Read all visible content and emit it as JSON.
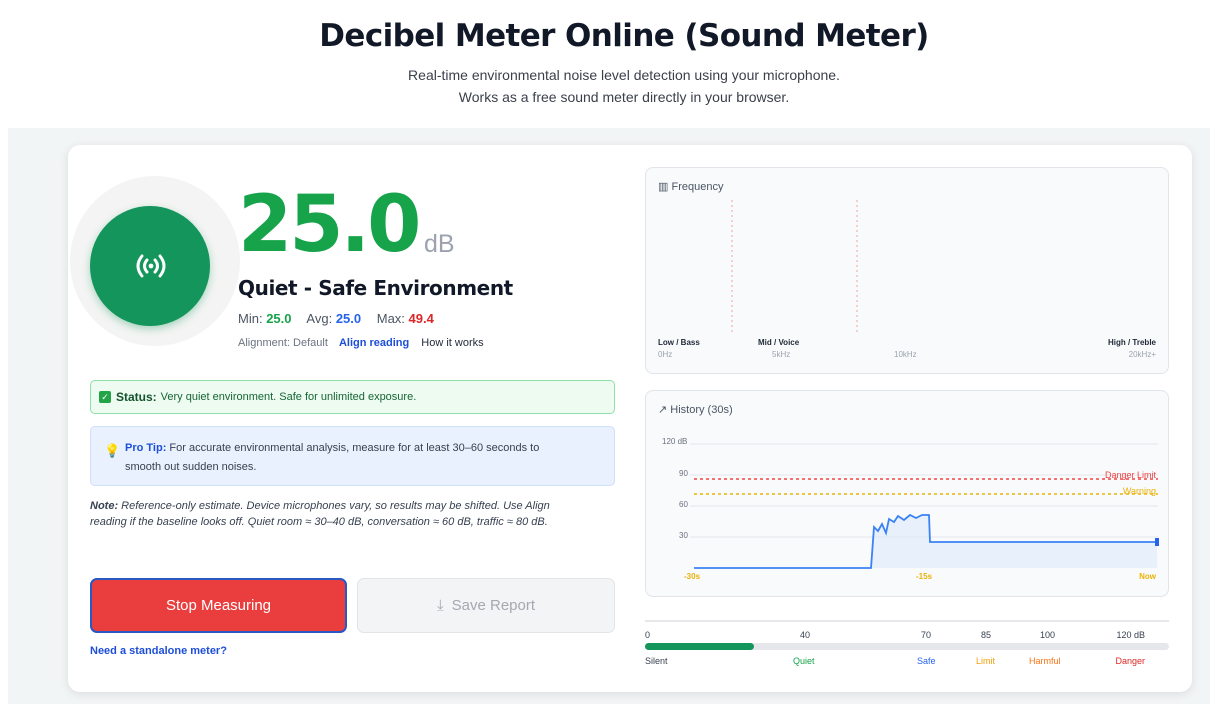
{
  "header": {
    "title": "Decibel Meter Online (Sound Meter)",
    "subtitle_line1": "Real-time environmental noise level detection using your microphone.",
    "subtitle_line2": "Works as a free sound meter directly in your browser."
  },
  "meter": {
    "value": "25.0",
    "unit": "dB",
    "level_text": "Quiet - Safe Environment",
    "min_label": "Min:",
    "min_value": "25.0",
    "avg_label": "Avg:",
    "avg_value": "25.0",
    "max_label": "Max:",
    "max_value": "49.4",
    "alignment_label": "Alignment: Default",
    "align_link": "Align reading",
    "how_link": "How it works",
    "icon": "sound-wave-icon",
    "accent_color": "#16a34a"
  },
  "status": {
    "label": "Status:",
    "text": "Very quiet environment. Safe for unlimited exposure."
  },
  "tip": {
    "label": "Pro Tip:",
    "line1": "For accurate environmental analysis, measure for at least 30–60 seconds to",
    "line2": "smooth out sudden noises."
  },
  "note": {
    "label": "Note:",
    "line1": "Reference-only estimate. Device microphones vary, so results may be shifted. Use Align",
    "line2": "reading if the baseline looks off. Quiet room ≈ 30–40 dB, conversation ≈ 60 dB, traffic ≈ 80 dB."
  },
  "buttons": {
    "stop": "Stop Measuring",
    "save": "Save Report",
    "standalone": "Need a standalone meter?"
  },
  "frequency": {
    "title": "Frequency",
    "bands": [
      "Low / Bass",
      "Mid / Voice",
      "High / Treble"
    ],
    "hz_labels": [
      "0Hz",
      "5kHz",
      "10kHz",
      "20kHz+"
    ]
  },
  "history": {
    "title": "History (30s)",
    "y_ticks": [
      "120 dB",
      "90",
      "60",
      "30"
    ],
    "x_ticks": [
      "-30s",
      "-15s",
      "Now"
    ],
    "danger_label": "Danger Limit",
    "warning_label": "Warning",
    "line_color": "#3b82f6",
    "danger_color": "#ef4444",
    "warning_color": "#eab308"
  },
  "scale": {
    "numbers": [
      "0",
      "40",
      "70",
      "85",
      "100",
      "120 dB"
    ],
    "zones": [
      {
        "label": "Silent",
        "color": "#374151"
      },
      {
        "label": "Quiet",
        "color": "#16a34a"
      },
      {
        "label": "Safe",
        "color": "#2563eb"
      },
      {
        "label": "Limit",
        "color": "#f59e0b"
      },
      {
        "label": "Harmful",
        "color": "#f97316"
      },
      {
        "label": "Danger",
        "color": "#dc2626"
      }
    ],
    "current_fraction": 0.2083
  }
}
